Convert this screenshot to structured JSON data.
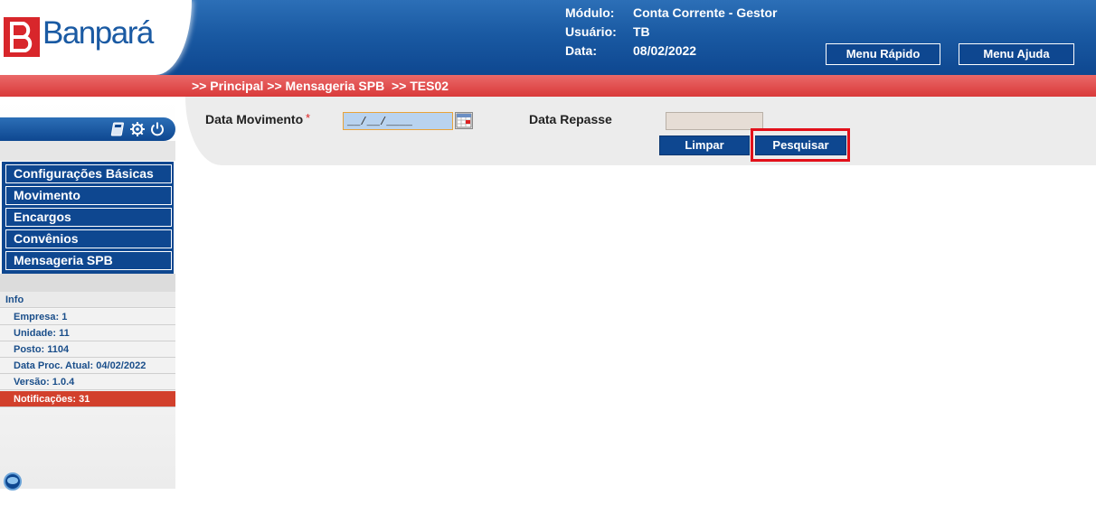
{
  "header": {
    "brand": "Banpará",
    "modulo_label": "Módulo:",
    "modulo_value": "Conta Corrente - Gestor",
    "usuario_label": "Usuário:",
    "usuario_value": "TB",
    "data_label": "Data:",
    "data_value": "08/02/2022",
    "menu_rapido": "Menu Rápido",
    "menu_ajuda": "Menu Ajuda"
  },
  "breadcrumb": ">> Principal >> Mensageria SPB  >> TES02",
  "form": {
    "data_movimento_label": "Data Movimento",
    "required_mark": "*",
    "data_movimento_value": "__/__/____",
    "data_repasse_label": "Data Repasse",
    "data_repasse_value": "",
    "limpar": "Limpar",
    "pesquisar": "Pesquisar"
  },
  "sidebar": {
    "menu": [
      {
        "label": "Configurações Básicas"
      },
      {
        "label": "Movimento"
      },
      {
        "label": "Encargos"
      },
      {
        "label": "Convênios"
      },
      {
        "label": "Mensageria SPB"
      }
    ],
    "info_title": "Info",
    "info": [
      {
        "text": "Empresa: 1"
      },
      {
        "text": "Unidade: 11"
      },
      {
        "text": "Posto: 1104"
      },
      {
        "text": "Data Proc. Atual: 04/02/2022"
      },
      {
        "text": "Versão: 1.0.4"
      }
    ],
    "notifications": "Notificações: 31",
    "tool_icons": [
      "calculator-icon",
      "settings-icon",
      "power-icon"
    ]
  },
  "colors": {
    "header_blue": "#1a5aa3",
    "button_navy": "#0e4790",
    "breadcrumb_red": "#d93a3a",
    "notification_red": "#d2402c",
    "highlight_red": "#e2101a"
  }
}
